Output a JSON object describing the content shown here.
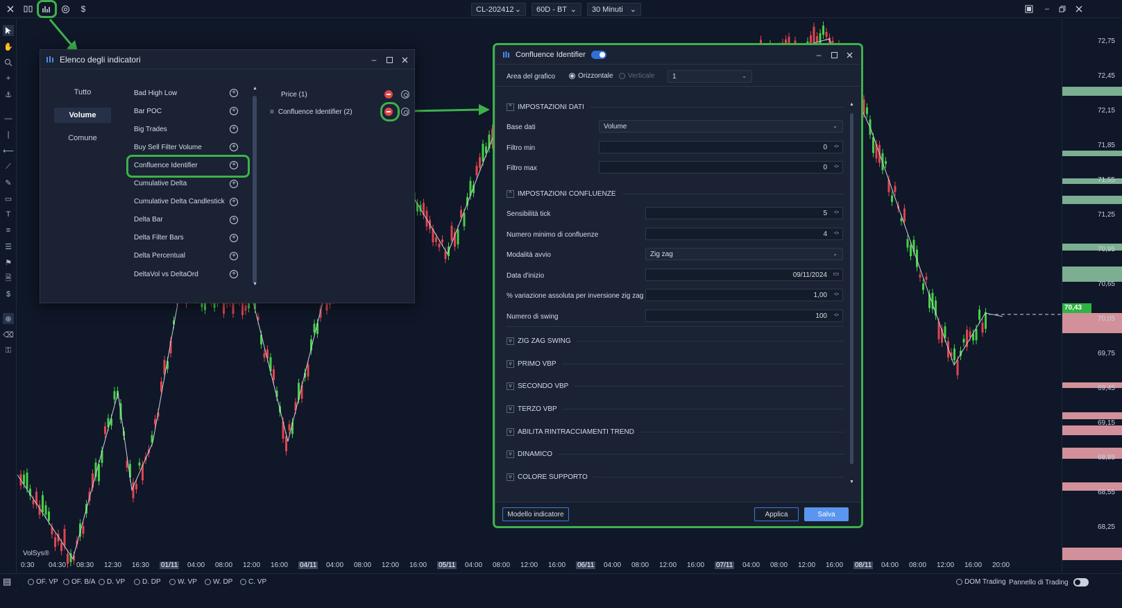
{
  "topbar": {
    "symbol": "CL-202412",
    "range": "60D - BT",
    "timeframe": "30 Minuti"
  },
  "colors": {
    "accent_blue": "#2f6fd8",
    "highlight_green": "#3fb04c",
    "bull_candle": "#47d147",
    "bear_candle": "#e0454f",
    "remove_red": "#e0454f"
  },
  "indicators_window": {
    "title": "Elenco degli indicatori",
    "categories": [
      "Tutto",
      "Volume",
      "Comune"
    ],
    "active_category": "Volume",
    "items": [
      "Bad High Low",
      "Bar POC",
      "Big Trades",
      "Buy Sell Filter Volume",
      "Confluence Identifier",
      "Cumulative Delta",
      "Cumulative Delta Candlestick",
      "Delta Bar",
      "Delta Filter Bars",
      "Delta Percentual",
      "DeltaVol vs DeltaOrd"
    ],
    "applied": [
      "Price (1)",
      "Confluence Identifier (2)"
    ]
  },
  "confluence_window": {
    "title": "Confluence Identifier",
    "area_label": "Area del grafico",
    "orient_horizontal": "Orizzontale",
    "orient_vertical": "Verticale",
    "area_value": "1",
    "sections": {
      "dati": "IMPOSTAZIONI DATI",
      "confluenze": "IMPOSTAZIONI CONFLUENZE",
      "zigzag": "ZIG ZAG SWING",
      "primo": "PRIMO VBP",
      "secondo": "SECONDO VBP",
      "terzo": "TERZO VBP",
      "rintracciamenti": "ABILITA RINTRACCIAMENTI TREND",
      "dinamico": "DINAMICO",
      "supporto": "COLORE SUPPORTO"
    },
    "fields": {
      "base_dati": {
        "label": "Base dati",
        "value": "Volume"
      },
      "filtro_min": {
        "label": "Filtro min",
        "value": "0"
      },
      "filtro_max": {
        "label": "Filtro max",
        "value": "0"
      },
      "sensibilita": {
        "label": "Sensibilità tick",
        "value": "5"
      },
      "numero_min": {
        "label": "Numero minimo di confluenze",
        "value": "4"
      },
      "modalita": {
        "label": "Modalità avvio",
        "value": "Zig zag"
      },
      "data_inizio": {
        "label": "Data d'inizio",
        "value": "09/11/2024"
      },
      "variazione": {
        "label": "% variazione assoluta per inversione zig zag",
        "value": "1,00"
      },
      "numero_swing": {
        "label": "Numero di swing",
        "value": "100"
      }
    },
    "buttons": {
      "template": "Modello indicatore",
      "apply": "Applica",
      "save": "Salva"
    }
  },
  "price_scale": {
    "labels": [
      "72,75",
      "72,45",
      "72,15",
      "71,85",
      "71,55",
      "71,25",
      "70,95",
      "70,65",
      "70,05",
      "69,75",
      "69,45",
      "69,15",
      "68,85",
      "68,55",
      "68,25"
    ],
    "last_price": "70,43"
  },
  "time_axis": {
    "labels": [
      "0:30",
      "04:30",
      "08:30",
      "12:30",
      "16:30",
      "01/11",
      "04:00",
      "08:00",
      "12:00",
      "16:00",
      "04/11",
      "04:00",
      "08:00",
      "12:00",
      "16:00",
      "05/11",
      "04:00",
      "08:00",
      "12:00",
      "16:00",
      "06/11",
      "04:00",
      "08:00",
      "12:00",
      "16:00",
      "07/11",
      "04:00",
      "08:00",
      "12:00",
      "16:00",
      "08/11",
      "04:00",
      "08:00",
      "12:00",
      "16:00",
      "20:00"
    ]
  },
  "watermark": "VolSys®",
  "bottombar": {
    "toggles": [
      "OF. VP",
      "OF. B/A",
      "D. VP",
      "D. DP",
      "W. VP",
      "W. DP",
      "C. VP"
    ],
    "dom": "DOM Trading",
    "panel": "Pannello di Trading"
  }
}
